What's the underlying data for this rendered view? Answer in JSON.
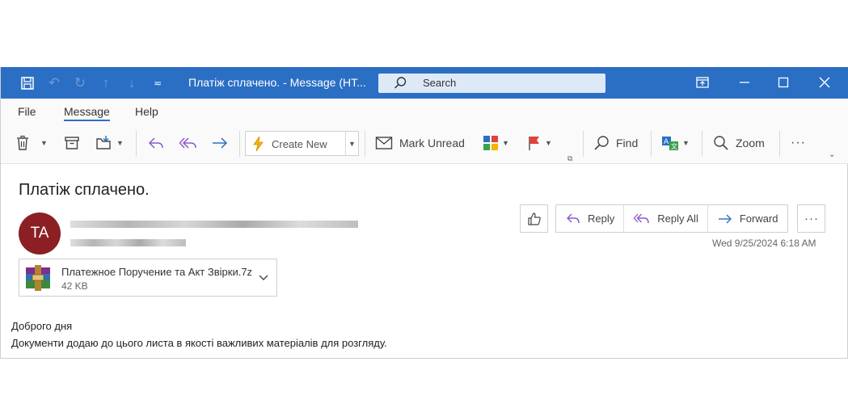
{
  "window": {
    "title": "Платіж сплачено.  -  Message (HT...",
    "search_placeholder": "Search"
  },
  "menu": {
    "items": [
      "File",
      "Message",
      "Help"
    ],
    "active": "Message"
  },
  "ribbon": {
    "create_new": "Create New",
    "mark_unread": "Mark Unread",
    "find": "Find",
    "zoom": "Zoom",
    "more": "···"
  },
  "message": {
    "subject": "Платіж сплачено.",
    "sender_initials": "TA",
    "actions": {
      "reply": "Reply",
      "reply_all": "Reply All",
      "forward": "Forward",
      "more": "···"
    },
    "date": "Wed 9/25/2024 6:18 AM",
    "attachment": {
      "name": "Платежное Поручение та Акт Звірки.7z",
      "size": "42 KB"
    },
    "body": [
      "Доброго дня",
      "Документи додаю до цього листа в якості важливих матеріалів для розгляду."
    ]
  },
  "colors": {
    "titlebar": "#2b6fc4",
    "avatar": "#8b1f24",
    "accent_purple": "#8b5ac9",
    "accent_blue": "#2b6fc4"
  }
}
